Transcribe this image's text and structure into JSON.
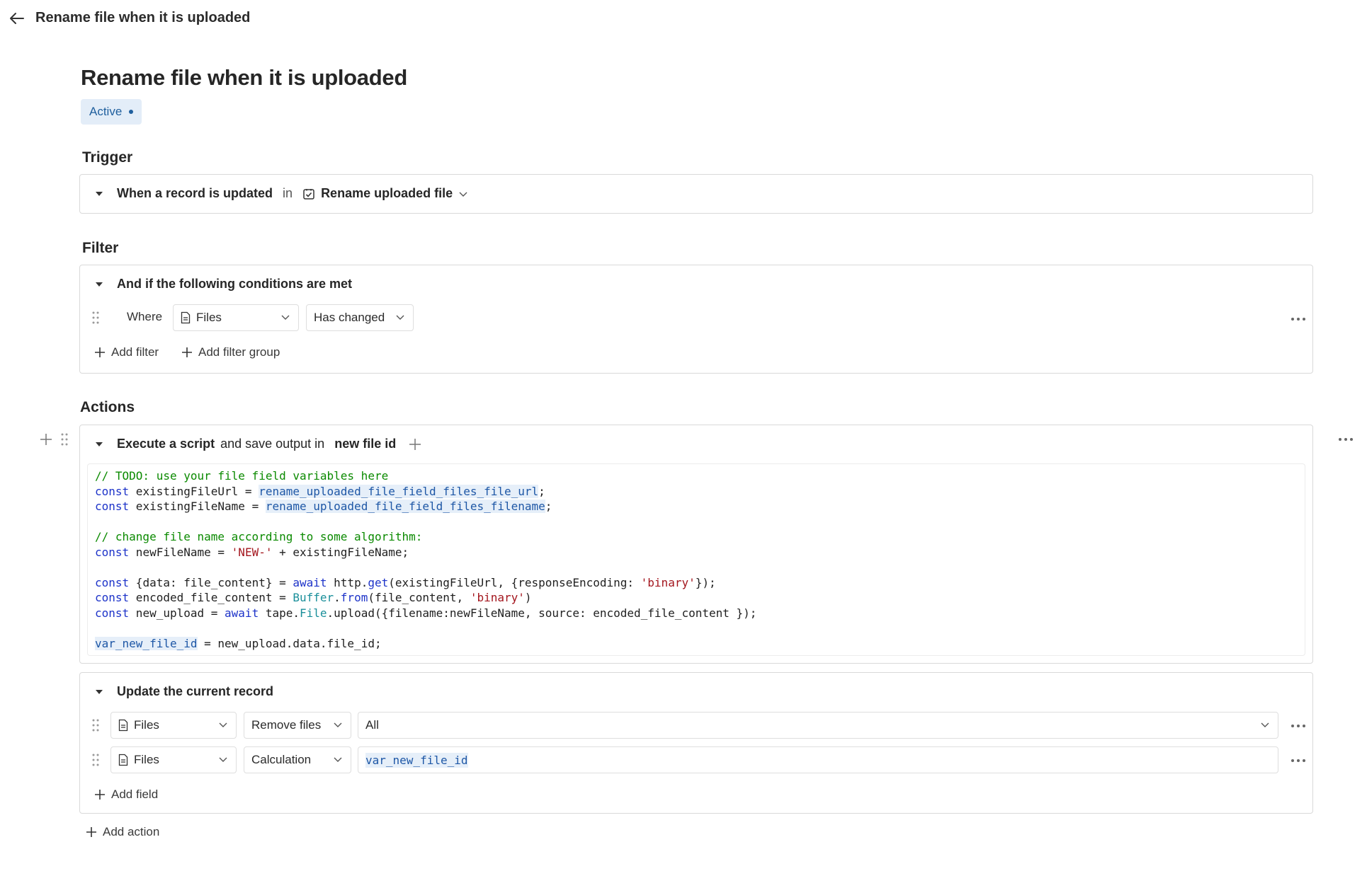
{
  "header": {
    "title": "Rename file when it is uploaded"
  },
  "automation": {
    "title": "Rename file when it is uploaded",
    "status": "Active"
  },
  "trigger": {
    "heading": "Trigger",
    "event": "When a record is updated",
    "preposition": "in",
    "app_name": "Rename uploaded file"
  },
  "filter": {
    "heading": "Filter",
    "title": "And if the following conditions are met",
    "where_label": "Where",
    "field": "Files",
    "condition": "Has changed",
    "add_filter": "Add filter",
    "add_filter_group": "Add filter group"
  },
  "actions": {
    "heading": "Actions",
    "script": {
      "title_bold": "Execute a script",
      "title_rest": "and save output in",
      "output_var": "new file id",
      "code": [
        [
          {
            "t": "// TODO: use your file field variables here",
            "c": "com"
          }
        ],
        [
          {
            "t": "const",
            "c": "kw"
          },
          {
            "t": " existingFileUrl = "
          },
          {
            "t": "rename_uploaded_file_field_files_file_url",
            "c": "var"
          },
          {
            "t": ";"
          }
        ],
        [
          {
            "t": "const",
            "c": "kw"
          },
          {
            "t": " existingFileName = "
          },
          {
            "t": "rename_uploaded_file_field_files_filename",
            "c": "var"
          },
          {
            "t": ";"
          }
        ],
        [],
        [
          {
            "t": "// change file name according to some algorithm:",
            "c": "com"
          }
        ],
        [
          {
            "t": "const",
            "c": "kw"
          },
          {
            "t": " newFileName = "
          },
          {
            "t": "'NEW-'",
            "c": "str"
          },
          {
            "t": " + existingFileName;"
          }
        ],
        [],
        [
          {
            "t": "const",
            "c": "kw"
          },
          {
            "t": " {data: file_content} = "
          },
          {
            "t": "await",
            "c": "kw"
          },
          {
            "t": " http."
          },
          {
            "t": "get",
            "c": "fn"
          },
          {
            "t": "(existingFileUrl, {responseEncoding: "
          },
          {
            "t": "'binary'",
            "c": "str"
          },
          {
            "t": "});"
          }
        ],
        [
          {
            "t": "const",
            "c": "kw"
          },
          {
            "t": " encoded_file_content = "
          },
          {
            "t": "Buffer",
            "c": "cls"
          },
          {
            "t": "."
          },
          {
            "t": "from",
            "c": "fn"
          },
          {
            "t": "(file_content, "
          },
          {
            "t": "'binary'",
            "c": "str"
          },
          {
            "t": ")"
          }
        ],
        [
          {
            "t": "const",
            "c": "kw"
          },
          {
            "t": " new_upload = "
          },
          {
            "t": "await",
            "c": "kw"
          },
          {
            "t": " tape."
          },
          {
            "t": "File",
            "c": "cls"
          },
          {
            "t": ".upload({filename:newFileName, source: encoded_file_content });"
          }
        ],
        [],
        [
          {
            "t": "var_new_file_id",
            "c": "var"
          },
          {
            "t": " = new_upload.data.file_id;"
          }
        ]
      ]
    },
    "update": {
      "title": "Update the current record",
      "rows": [
        {
          "field": "Files",
          "operation": "Remove files",
          "value": "All"
        },
        {
          "field": "Files",
          "operation": "Calculation",
          "value": "var_new_file_id"
        }
      ],
      "add_field": "Add field"
    },
    "add_action": "Add action"
  }
}
